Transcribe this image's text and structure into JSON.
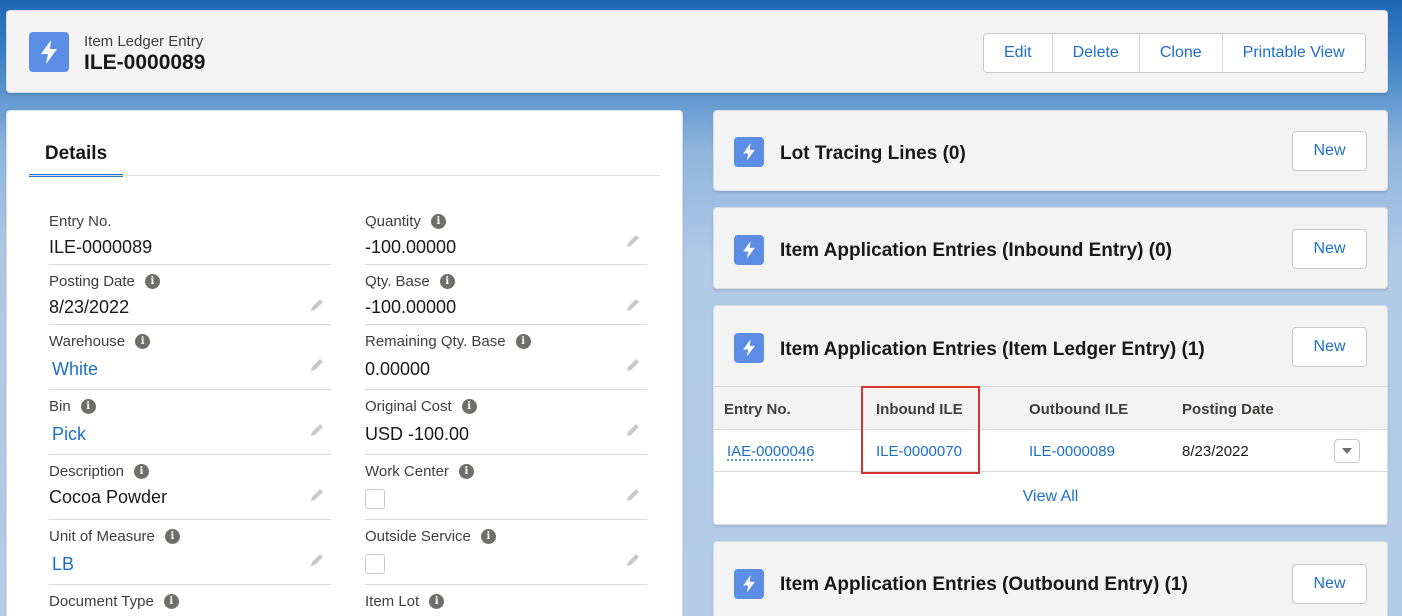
{
  "header": {
    "object_type": "Item Ledger Entry",
    "record_name": "ILE-0000089",
    "icon": "lightning-bolt-icon",
    "buttons": [
      "Edit",
      "Delete",
      "Clone",
      "Printable View"
    ]
  },
  "details": {
    "tab_label": "Details",
    "left_fields": [
      {
        "label": "Entry No.",
        "value": "ILE-0000089"
      },
      {
        "label": "Posting Date",
        "value": "8/23/2022"
      },
      {
        "label": "Warehouse",
        "value": "White"
      },
      {
        "label": "Bin",
        "value": "Pick"
      },
      {
        "label": "Description",
        "value": "Cocoa Powder"
      },
      {
        "label": "Unit of Measure",
        "value": "LB"
      },
      {
        "label": "Document Type",
        "value": ""
      }
    ],
    "right_fields": [
      {
        "label": "Quantity",
        "value": "-100.00000"
      },
      {
        "label": "Qty. Base",
        "value": "-100.00000"
      },
      {
        "label": "Remaining Qty. Base",
        "value": "0.00000"
      },
      {
        "label": "Original Cost",
        "value": "USD -100.00"
      },
      {
        "label": "Work Center",
        "value": ""
      },
      {
        "label": "Outside Service",
        "value": ""
      },
      {
        "label": "Item Lot",
        "value": ""
      }
    ]
  },
  "related": {
    "new_label": "New",
    "lot_tracing": {
      "title": "Lot Tracing Lines (0)"
    },
    "inbound": {
      "title": "Item Application Entries (Inbound Entry) (0)"
    },
    "item_ledger": {
      "title": "Item Application Entries (Item Ledger Entry) (1)",
      "columns": [
        "Entry No.",
        "Inbound ILE",
        "Outbound ILE",
        "Posting Date"
      ],
      "rows": [
        {
          "entry_no": "IAE-0000046",
          "inbound_ile": "ILE-0000070",
          "outbound_ile": "ILE-0000089",
          "posting_date": "8/23/2022"
        }
      ],
      "view_all": "View All"
    },
    "outbound": {
      "title": "Item Application Entries (Outbound Entry) (1)"
    }
  },
  "colors": {
    "accent": "#1b6fc8",
    "icon_bg": "#5a8de3",
    "highlight": "#d9342b"
  }
}
